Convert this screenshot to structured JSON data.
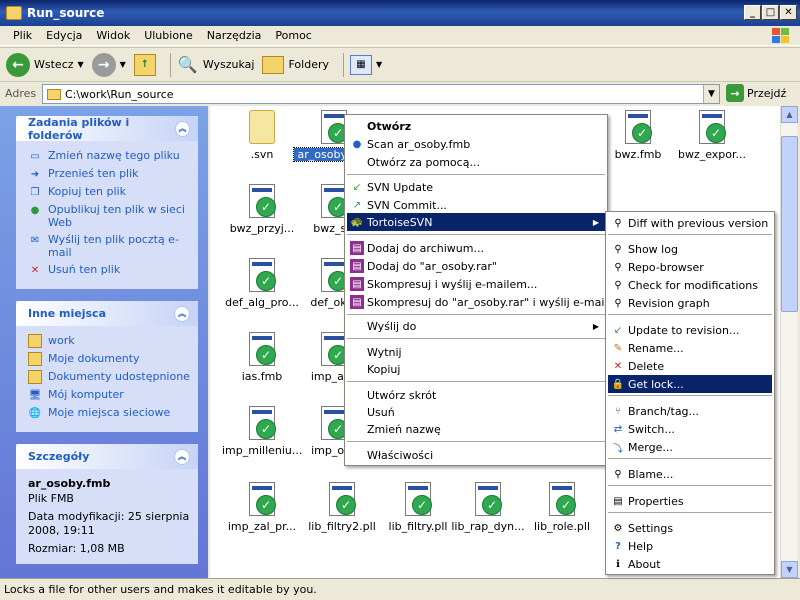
{
  "window": {
    "title": "Run_source"
  },
  "menubar": [
    "Plik",
    "Edycja",
    "Widok",
    "Ulubione",
    "Narzędzia",
    "Pomoc"
  ],
  "toolbar": {
    "back": "Wstecz",
    "search": "Wyszukaj",
    "folders": "Foldery"
  },
  "address": {
    "label": "Adres",
    "path": "C:\\work\\Run_source",
    "go": "Przejdź"
  },
  "tasks_panel": {
    "title": "Zadania plików i folderów",
    "items": [
      "Zmień nazwę tego pliku",
      "Przenieś ten plik",
      "Kopiuj ten plik",
      "Opublikuj ten plik w sieci Web",
      "Wyślij ten plik pocztą e-mail",
      "Usuń ten plik"
    ]
  },
  "places_panel": {
    "title": "Inne miejsca",
    "items": [
      "work",
      "Moje dokumenty",
      "Dokumenty udostępnione",
      "Mój komputer",
      "Moje miejsca sieciowe"
    ]
  },
  "details_panel": {
    "title": "Szczegóły",
    "filename": "ar_osoby.fmb",
    "filetype": "Plik FMB",
    "modified": "Data modyfikacji: 25 sierpnia 2008, 19:11",
    "size": "Rozmiar: 1,08 MB"
  },
  "files": [
    ".svn",
    "ar_osoby.fmb",
    "bwz.fmb",
    "bwz_expor...",
    "bwz_przyj...",
    "bwz_sl_",
    "def_alg_pro...",
    "def_okre",
    "ias.fmb",
    "imp_ank",
    "imp_milleniu...",
    "imp_oce",
    "imp_zal_pr...",
    "lib_filtry2.pll",
    "lib_filtry.pll",
    "lib_rap_dyn...",
    "lib_role.pll"
  ],
  "context_menu": {
    "items": [
      "Otwórz",
      "Scan ar_osoby.fmb",
      "Otwórz za pomocą...",
      "SVN Update",
      "SVN Commit...",
      "TortoiseSVN",
      "Dodaj do archiwum...",
      "Dodaj do \"ar_osoby.rar\"",
      "Skompresuj i wyślij e-mailem...",
      "Skompresuj do \"ar_osoby.rar\" i wyślij e-mailem",
      "Wyślij do",
      "Wytnij",
      "Kopiuj",
      "Utwórz skrót",
      "Usuń",
      "Zmień nazwę",
      "Właściwości"
    ]
  },
  "submenu": {
    "items": [
      "Diff with previous version",
      "Show log",
      "Repo-browser",
      "Check for modifications",
      "Revision graph",
      "Update to revision...",
      "Rename...",
      "Delete",
      "Get lock...",
      "Branch/tag...",
      "Switch...",
      "Merge...",
      "Blame...",
      "Properties",
      "Settings",
      "Help",
      "About"
    ]
  },
  "status": {
    "text": "Locks a file for other users and makes it editable by you."
  },
  "colors": {
    "selection": "#0A246A",
    "task_link": "#215DC6",
    "svn_ok": "#2FA84F"
  }
}
